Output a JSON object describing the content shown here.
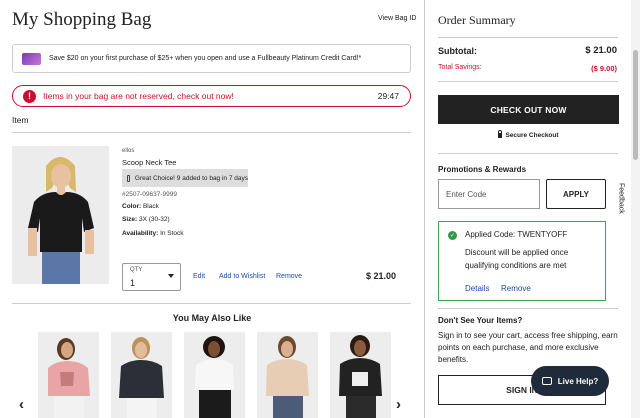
{
  "header": {
    "title": "My Shopping Bag",
    "view_bag_id": "View Bag ID"
  },
  "promo_banner": {
    "text": "Save $20 on your first purchase of $25+ when you open and use a Fullbeauty Platinum Credit Card!*"
  },
  "alert": {
    "text": "Items in your bag are not reserved, check out now!",
    "timer": "29:47"
  },
  "item_section": {
    "header": "Item"
  },
  "item": {
    "brand": "ellos",
    "name": "Scoop Neck Tee",
    "badge": "Great Choice! 9 added to bag in 7 days",
    "sku": "#2507-09637-9999",
    "color_label": "Color:",
    "color_value": "Black",
    "size_label": "Size:",
    "size_value": "3X (30-32)",
    "availability_label": "Availability:",
    "availability_value": "In Stock",
    "qty_label": "QTY",
    "qty_value": "1",
    "edit": "Edit",
    "add_to_wishlist": "Add to Wishlist",
    "remove": "Remove",
    "price": "$ 21.00"
  },
  "you_may_also_like": {
    "title": "You May Also Like"
  },
  "summary": {
    "title": "Order Summary",
    "subtotal_label": "Subtotal:",
    "subtotal_value": "$ 21.00",
    "savings_label": "Total Savings:",
    "savings_value": "($ 9.00)",
    "checkout_label": "CHECK OUT NOW",
    "secure_label": "Secure Checkout"
  },
  "promotions": {
    "title": "Promotions & Rewards",
    "input_placeholder": "Enter Code",
    "apply_label": "APPLY",
    "applied_code": "Applied Code: TWENTYOFF",
    "applied_note": "Discount will be applied once qualifying conditions are met",
    "details_label": "Details",
    "remove_label": "Remove"
  },
  "dont_see": {
    "title": "Don't See Your Items?",
    "text": "Sign in to see your cart, access free shipping, earn points on each purchase, and more exclusive benefits.",
    "signin_label": "SIGN IN"
  },
  "feedback": {
    "label": "Feedback"
  },
  "live_help": {
    "label": "Live Help?"
  },
  "colors": {
    "alert_red": "#c8102e",
    "link_blue": "#1a4fa0",
    "applied_green": "#3aa655",
    "checkout_bg": "#222222",
    "live_help_bg": "#1f2b3a"
  }
}
